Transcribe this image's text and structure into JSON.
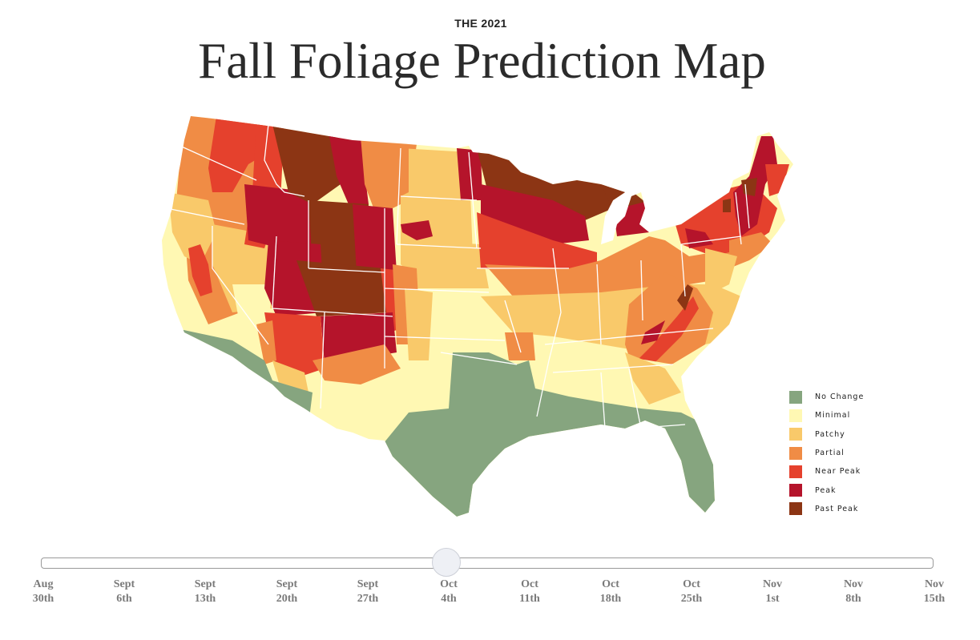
{
  "header": {
    "kicker": "THE 2021",
    "title": "Fall Foliage Prediction Map"
  },
  "colors": {
    "no_change": "#86a57f",
    "minimal": "#fff8b3",
    "patchy": "#f9c96a",
    "partial": "#f08c45",
    "near_peak": "#e5412d",
    "peak": "#b5142b",
    "past_peak": "#8c3514",
    "border": "#ffffff"
  },
  "legend": {
    "items": [
      {
        "label": "No Change",
        "key": "no_change",
        "color": "#86a57f"
      },
      {
        "label": "Minimal",
        "key": "minimal",
        "color": "#fff8b3"
      },
      {
        "label": "Patchy",
        "key": "patchy",
        "color": "#f9c96a"
      },
      {
        "label": "Partial",
        "key": "partial",
        "color": "#f08c45"
      },
      {
        "label": "Near Peak",
        "key": "near_peak",
        "color": "#e5412d"
      },
      {
        "label": "Peak",
        "key": "peak",
        "color": "#b5142b"
      },
      {
        "label": "Past Peak",
        "key": "past_peak",
        "color": "#8c3514"
      }
    ]
  },
  "map": {
    "region": "Contiguous United States",
    "selected_date": "Oct 4th",
    "regions": [
      {
        "name": "Pacific coast (CA/OR/WA coast)",
        "status": "minimal"
      },
      {
        "name": "Western Washington & Oregon",
        "status": "partial"
      },
      {
        "name": "Cascades (WA/OR)",
        "status": "near_peak"
      },
      {
        "name": "Northern Idaho",
        "status": "near_peak"
      },
      {
        "name": "Western Montana",
        "status": "past_peak"
      },
      {
        "name": "Central Montana",
        "status": "peak"
      },
      {
        "name": "Eastern Montana",
        "status": "partial"
      },
      {
        "name": "Southern Idaho",
        "status": "peak"
      },
      {
        "name": "Wyoming",
        "status": "past_peak"
      },
      {
        "name": "Eastern Wyoming",
        "status": "peak"
      },
      {
        "name": "Utah",
        "status": "peak"
      },
      {
        "name": "Colorado Rockies",
        "status": "past_peak"
      },
      {
        "name": "Northern New Mexico",
        "status": "peak"
      },
      {
        "name": "Northern Arizona",
        "status": "near_peak"
      },
      {
        "name": "Nevada",
        "status": "patchy"
      },
      {
        "name": "Sierra Nevada",
        "status": "near_peak"
      },
      {
        "name": "Southern California & Arizona desert",
        "status": "no_change"
      },
      {
        "name": "Dakotas",
        "status": "patchy"
      },
      {
        "name": "Eastern North Dakota",
        "status": "peak"
      },
      {
        "name": "Northern Minnesota",
        "status": "past_peak"
      },
      {
        "name": "Central Minnesota & Wisconsin",
        "status": "peak"
      },
      {
        "name": "Upper Peninsula Michigan",
        "status": "past_peak"
      },
      {
        "name": "Northern Lower Michigan",
        "status": "peak"
      },
      {
        "name": "Southern Minnesota & Iowa",
        "status": "near_peak"
      },
      {
        "name": "Midwest (IL/IN/OH)",
        "status": "partial"
      },
      {
        "name": "Kansas & Oklahoma",
        "status": "minimal"
      },
      {
        "name": "Missouri & Kentucky",
        "status": "patchy"
      },
      {
        "name": "Appalachians (WV/VA/TN/NC)",
        "status": "near_peak"
      },
      {
        "name": "New York",
        "status": "near_peak"
      },
      {
        "name": "Vermont, New Hampshire & Maine",
        "status": "peak"
      },
      {
        "name": "Southern New England",
        "status": "partial"
      },
      {
        "name": "Mid-Atlantic",
        "status": "patchy"
      },
      {
        "name": "Southeast (TN/AL/GA/SC)",
        "status": "minimal"
      },
      {
        "name": "Texas, Gulf Coast & Florida",
        "status": "no_change"
      }
    ]
  },
  "slider": {
    "selected_index": 5,
    "selected_label": "Oct 4th",
    "ticks": [
      {
        "month": "Aug",
        "day": "30th"
      },
      {
        "month": "Sept",
        "day": "6th"
      },
      {
        "month": "Sept",
        "day": "13th"
      },
      {
        "month": "Sept",
        "day": "20th"
      },
      {
        "month": "Sept",
        "day": "27th"
      },
      {
        "month": "Oct",
        "day": "4th"
      },
      {
        "month": "Oct",
        "day": "11th"
      },
      {
        "month": "Oct",
        "day": "18th"
      },
      {
        "month": "Oct",
        "day": "25th"
      },
      {
        "month": "Nov",
        "day": "1st"
      },
      {
        "month": "Nov",
        "day": "8th"
      },
      {
        "month": "Nov",
        "day": "15th"
      }
    ]
  }
}
